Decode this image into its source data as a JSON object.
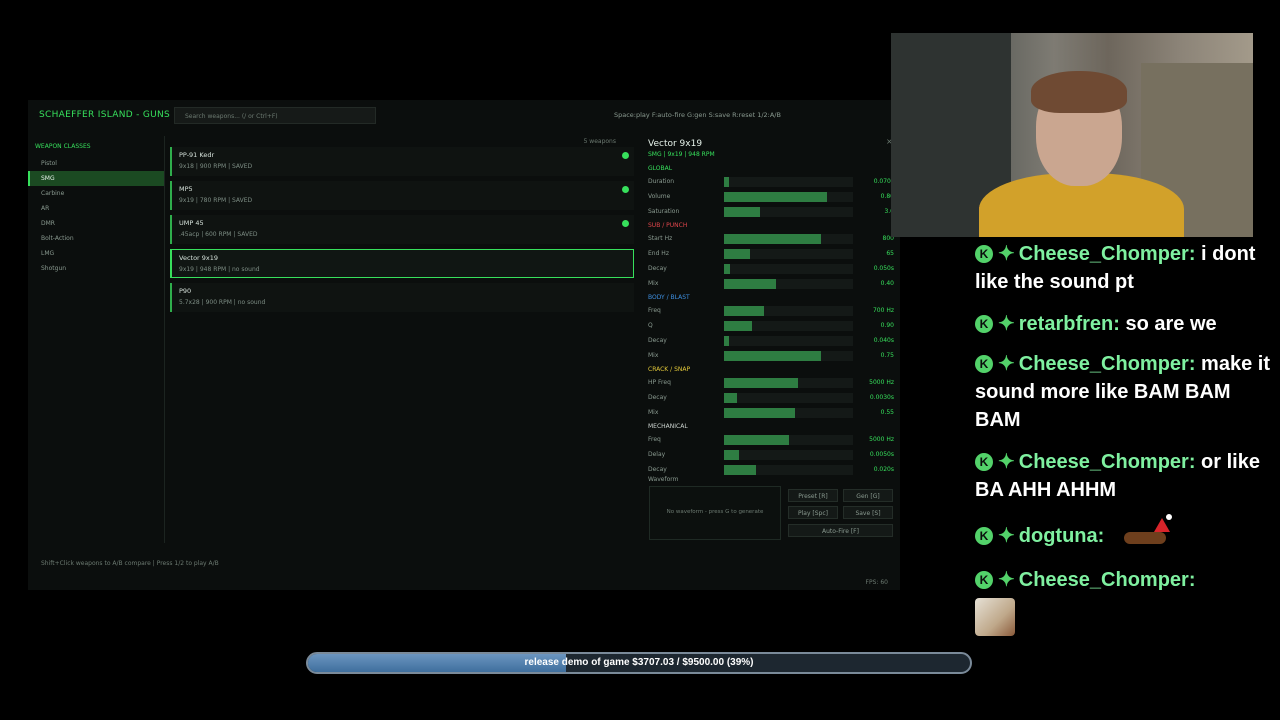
{
  "app": {
    "title": "SCHAEFFER ISLAND - GUNS",
    "search_placeholder": "Search weapons... (/ or Ctrl+F)",
    "hotkeys": "Space:play  F:auto-fire  G:gen  S:save  R:reset  1/2:A/B"
  },
  "sidebar": {
    "heading": "WEAPON CLASSES",
    "items": [
      "Pistol",
      "SMG",
      "Carbine",
      "AR",
      "DMR",
      "Bolt-Action",
      "LMG",
      "Shotgun"
    ],
    "active": "SMG"
  },
  "weapons": {
    "count_label": "5 weapons",
    "items": [
      {
        "name": "PP-91 Kedr",
        "stats": "9x18  |  900 RPM  |  SAVED",
        "saved": true
      },
      {
        "name": "MP5",
        "stats": "9x19  |  780 RPM  |  SAVED",
        "saved": true
      },
      {
        "name": "UMP 45",
        "stats": ".45acp  |  600 RPM  |  SAVED",
        "saved": true
      },
      {
        "name": "Vector 9x19",
        "stats": "9x19  |  948 RPM  |  no sound",
        "saved": false
      },
      {
        "name": "P90",
        "stats": "5.7x28  |  900 RPM  |  no sound",
        "saved": false
      }
    ]
  },
  "detail": {
    "title": "Vector 9x19",
    "subtitle": "SMG  |  9x19  |  948 RPM",
    "close_glyph": "×",
    "sections": [
      {
        "name": "GLOBAL",
        "color": "#37e05c",
        "params": [
          {
            "label": "Duration",
            "value": "0.070s",
            "fill": 0.04
          },
          {
            "label": "Volume",
            "value": "0.80",
            "fill": 0.8
          },
          {
            "label": "Saturation",
            "value": "3.0",
            "fill": 0.28
          }
        ]
      },
      {
        "name": "SUB / PUNCH",
        "color": "#e0454b",
        "params": [
          {
            "label": "Start Hz",
            "value": "800",
            "fill": 0.75
          },
          {
            "label": "End Hz",
            "value": "65",
            "fill": 0.2
          },
          {
            "label": "Decay",
            "value": "0.050s",
            "fill": 0.05
          },
          {
            "label": "Mix",
            "value": "0.40",
            "fill": 0.4
          }
        ]
      },
      {
        "name": "BODY / BLAST",
        "color": "#3e8fe0",
        "params": [
          {
            "label": "Freq",
            "value": "700 Hz",
            "fill": 0.31
          },
          {
            "label": "Q",
            "value": "0.90",
            "fill": 0.22
          },
          {
            "label": "Decay",
            "value": "0.040s",
            "fill": 0.04
          },
          {
            "label": "Mix",
            "value": "0.75",
            "fill": 0.75
          }
        ]
      },
      {
        "name": "CRACK / SNAP",
        "color": "#e3c93a",
        "params": [
          {
            "label": "HP Freq",
            "value": "5000 Hz",
            "fill": 0.57
          },
          {
            "label": "Decay",
            "value": "0.0030s",
            "fill": 0.1
          },
          {
            "label": "Mix",
            "value": "0.55",
            "fill": 0.55
          }
        ]
      },
      {
        "name": "MECHANICAL",
        "color": "#cfd6d2",
        "params": [
          {
            "label": "Freq",
            "value": "5000 Hz",
            "fill": 0.5
          },
          {
            "label": "Delay",
            "value": "0.0050s",
            "fill": 0.12
          },
          {
            "label": "Decay",
            "value": "0.020s",
            "fill": 0.25
          }
        ]
      }
    ],
    "waveform_label": "Waveform",
    "waveform_empty": "No waveform - press G to generate",
    "buttons": {
      "preset": "Preset [R]",
      "gen": "Gen [G]",
      "play": "Play [Spc]",
      "save": "Save [S]",
      "autofire": "Auto-Fire [F]"
    }
  },
  "footer": {
    "hint": "Shift+Click weapons to A/B compare  |  Press 1/2 to play A/B",
    "fps": "FPS: 60"
  },
  "chat": {
    "messages": [
      {
        "user": "Cheese_Chomper:",
        "text": "i dont like the sound pt"
      },
      {
        "user": "retarbfren:",
        "text": "so are we"
      },
      {
        "user": "Cheese_Chomper:",
        "text": "make it sound more like BAM BAM BAM"
      },
      {
        "user": "Cheese_Chomper:",
        "text": "or like BA AHH AHHM"
      },
      {
        "user": "dogtuna:",
        "text": ""
      },
      {
        "user": "Cheese_Chomper:",
        "text": ""
      }
    ],
    "badge_icon": "kick-badge-icon",
    "badge2_icon": "diamond-badge-icon"
  },
  "donation": {
    "text": "release demo of game $3707.03 / $9500.00 (39%)",
    "progress": 0.39
  },
  "colors": {
    "accent": "#37e05c",
    "chat_user": "#7ff0a0",
    "bar_fill": "#3f6f9d"
  }
}
